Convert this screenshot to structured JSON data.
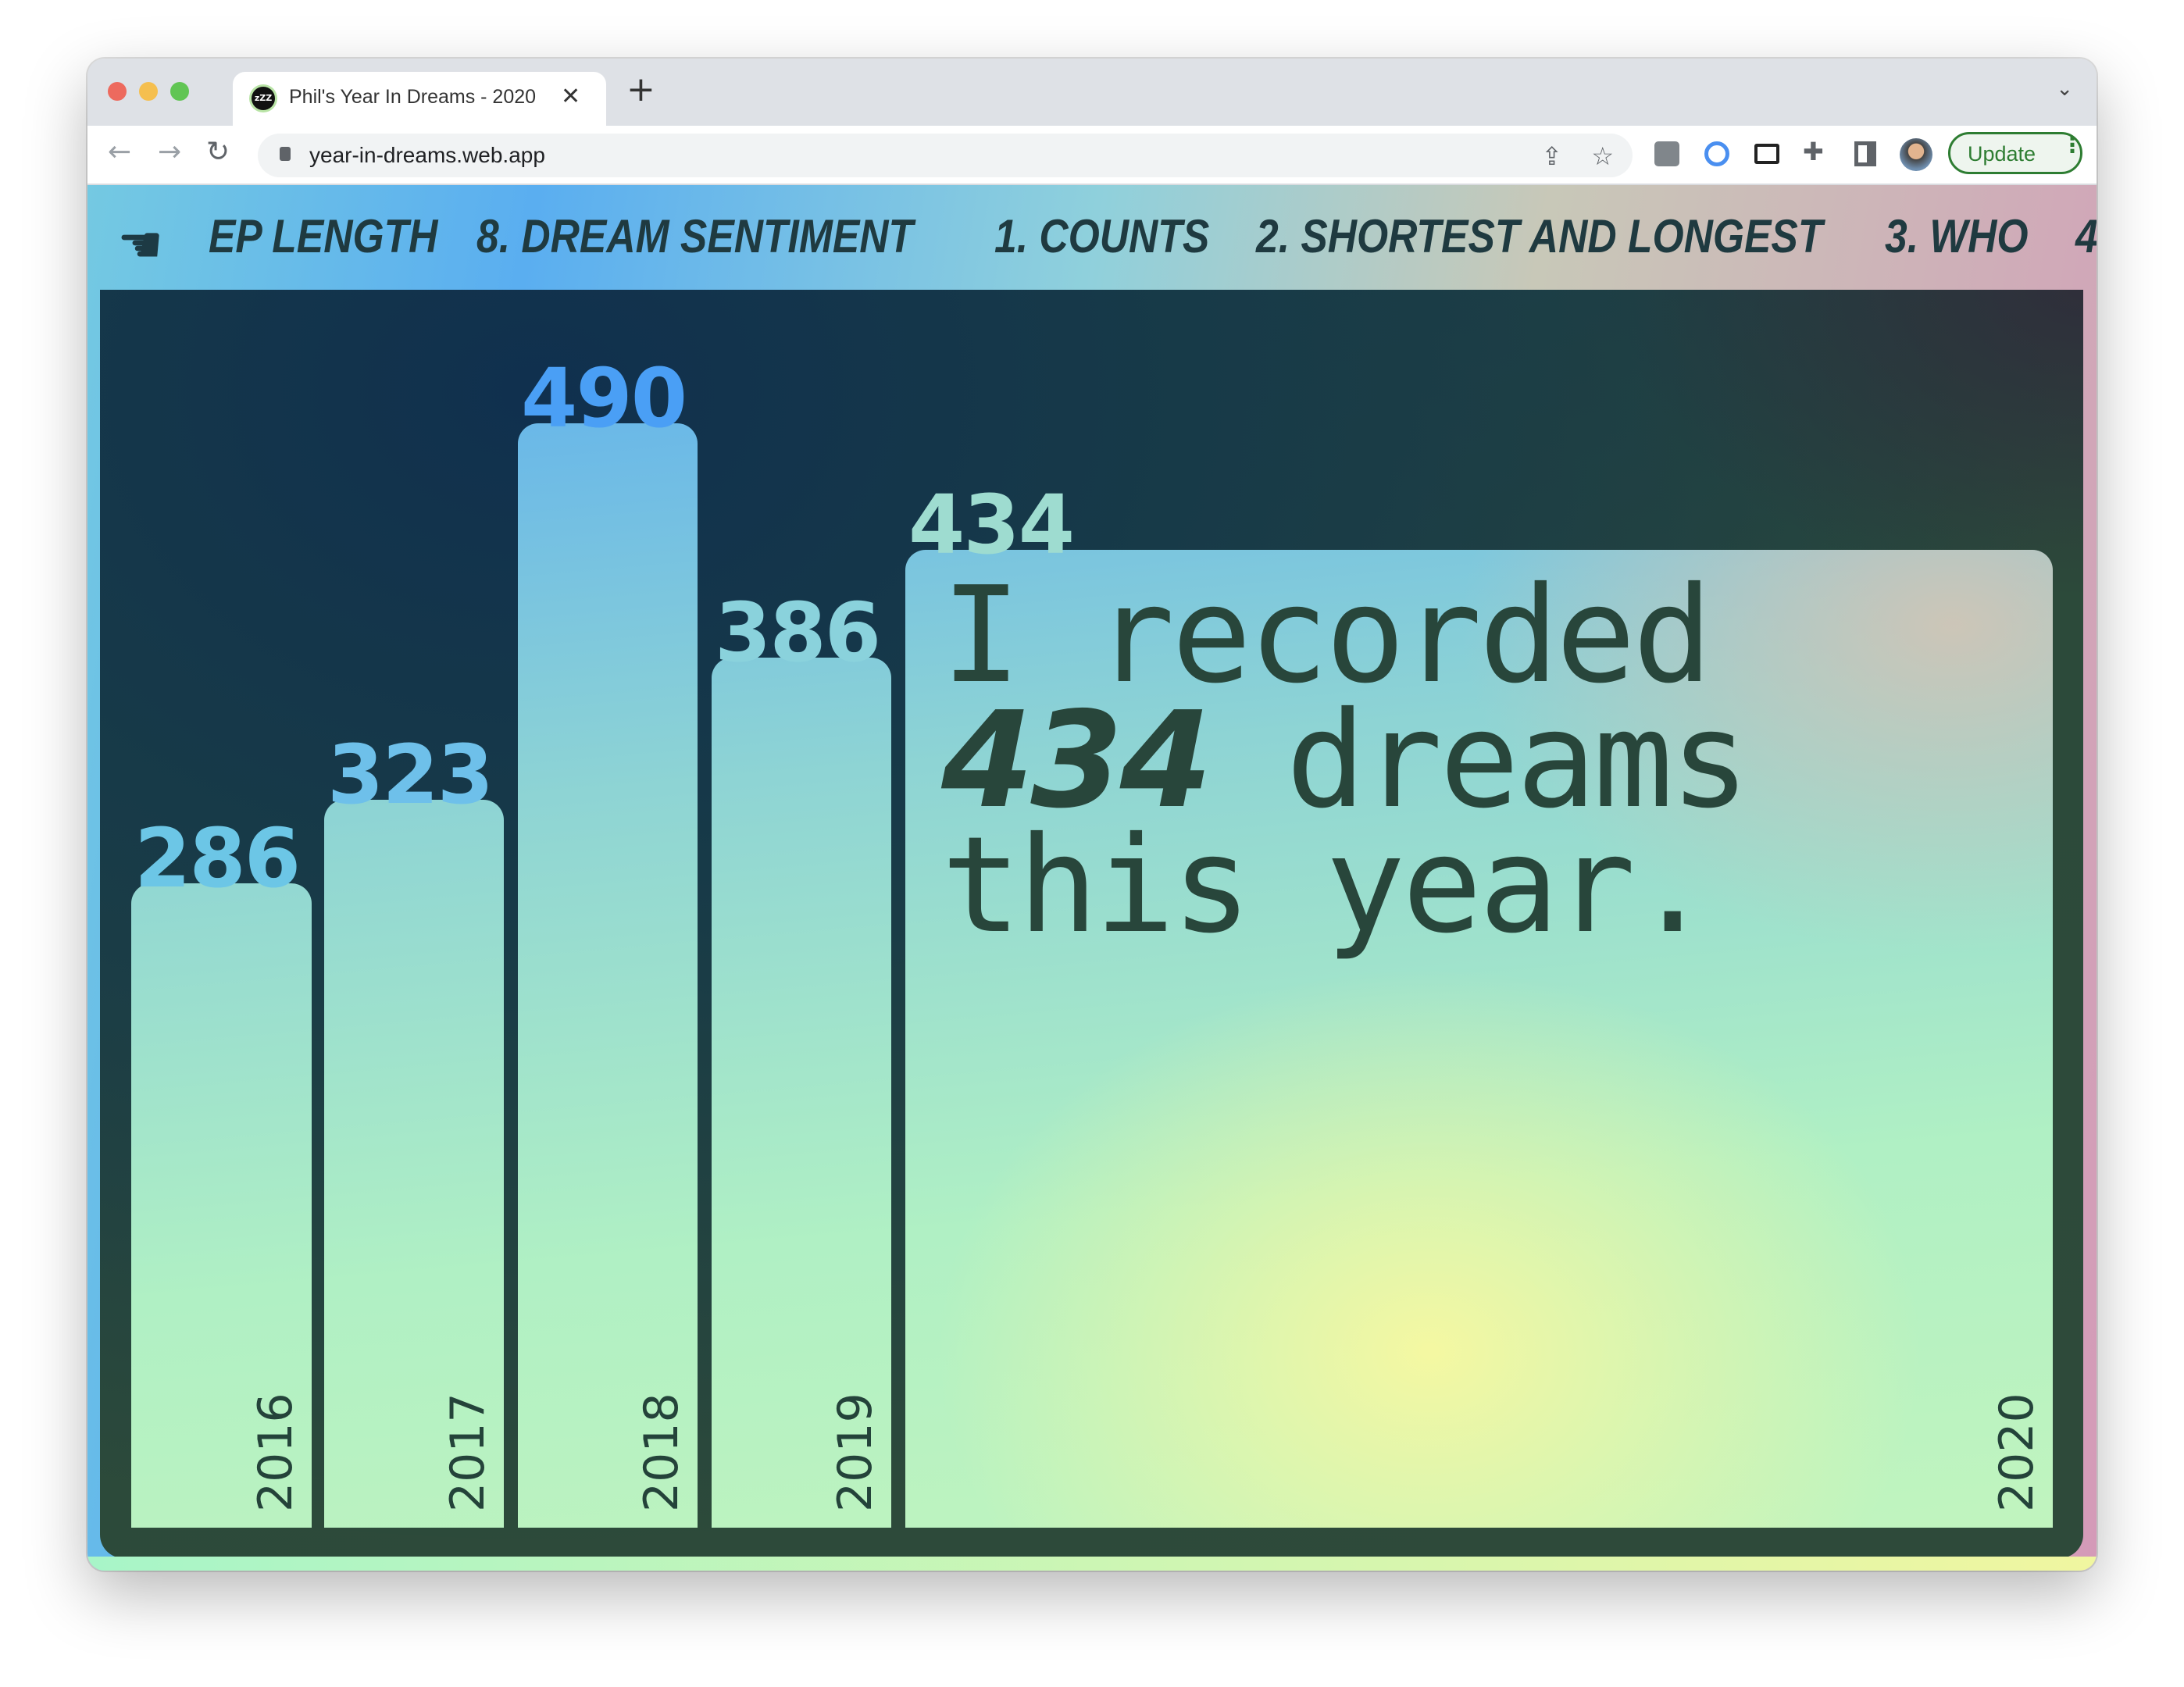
{
  "browser": {
    "tab_title": "Phil's Year In Dreams - 2020",
    "tab_favicon_text": "zZZ",
    "url": "year-in-dreams.web.app",
    "update_label": "Update",
    "traffic_light_colors": [
      "#ed6a5e",
      "#f5bf4f",
      "#61c554"
    ]
  },
  "nav": {
    "icon": "pointing-hand-icon",
    "items": [
      "EP LENGTH",
      "8. DREAM SENTIMENT",
      "1. COUNTS",
      "2. SHORTEST AND LONGEST",
      "3. WHO",
      "4"
    ]
  },
  "headline": {
    "prefix": "I recorded",
    "count": "434",
    "suffix": "dreams this year."
  },
  "chart_data": {
    "type": "bar",
    "categories": [
      "2016",
      "2017",
      "2018",
      "2019",
      "2020"
    ],
    "values": [
      286,
      323,
      490,
      386,
      434
    ],
    "value_labels": [
      "286",
      "323",
      "490",
      "386",
      "434"
    ],
    "highlight": "2020",
    "value_label_colors": [
      "#6cc6e6",
      "#6ec0ea",
      "#4a9ff5",
      "#8ad2dc",
      "#9edcd0"
    ]
  }
}
